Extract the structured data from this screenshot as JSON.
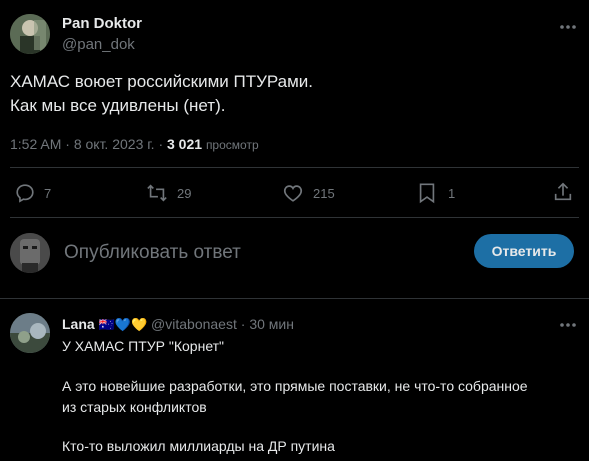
{
  "post": {
    "author_name": "Pan Doktor",
    "author_handle": "@pan_dok",
    "text_line1": "ХАМАС воюет российскими ПТУРами.",
    "text_line2": "Как мы все удивлены (нет).",
    "time": "1:52 AM",
    "date": "8 окт. 2023 г.",
    "views_count": "3 021",
    "views_label": "просмотр",
    "dot_sep": "·"
  },
  "actions": {
    "replies": "7",
    "reposts": "29",
    "likes": "215",
    "bookmarks": "1"
  },
  "composer": {
    "placeholder": "Опубликовать ответ",
    "button_label": "Ответить"
  },
  "reply": {
    "author_name": "Lana",
    "badges": "🇦🇺💙💛",
    "author_handle": "@vitabonaest",
    "dot_sep": "·",
    "time": "30 мин",
    "line1": "У ХАМАС ПТУР \"Корнет\"",
    "line2": "А это новейшие разработки, это прямые поставки, не что-то собранное",
    "line3": "из старых конфликтов",
    "line4": "Кто-то выложил миллиарды на ДР путина"
  },
  "colors": {
    "background": "#000000",
    "text": "#e7e9ea",
    "muted": "#71767b",
    "button": "#1d6fa5"
  },
  "icons": [
    "more-icon",
    "reply-icon",
    "repost-icon",
    "like-icon",
    "bookmark-icon",
    "share-icon"
  ]
}
